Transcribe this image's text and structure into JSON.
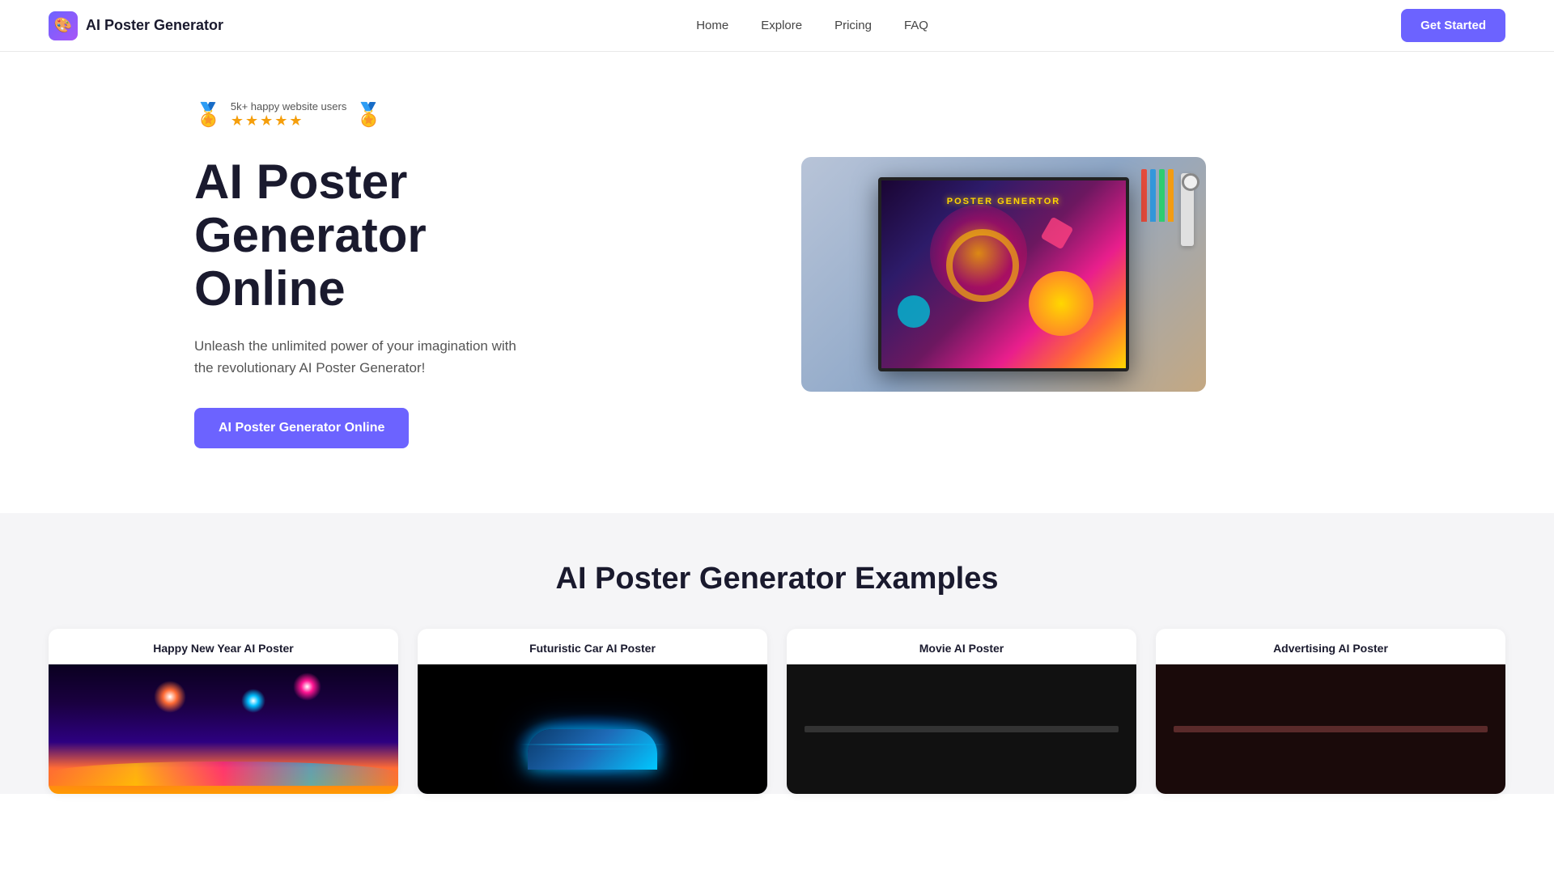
{
  "nav": {
    "logo_icon": "🎨",
    "logo_text": "AI Poster Generator",
    "links": [
      {
        "label": "Home",
        "id": "home"
      },
      {
        "label": "Explore",
        "id": "explore"
      },
      {
        "label": "Pricing",
        "id": "pricing"
      },
      {
        "label": "FAQ",
        "id": "faq"
      }
    ],
    "cta_label": "Get Started"
  },
  "hero": {
    "badge_users": "5k+ happy website users",
    "stars": "★★★★★",
    "title_line1": "AI Poster",
    "title_line2": "Generator",
    "title_line3": "Online",
    "subtitle": "Unleash the unlimited power of your imagination with the revolutionary AI Poster Generator!",
    "cta_label": "AI Poster Generator Online",
    "poster_label": "POSTER GENERTOR"
  },
  "examples": {
    "section_title": "AI Poster Generator Examples",
    "cards": [
      {
        "title": "Happy New Year AI Poster",
        "type": "new-year"
      },
      {
        "title": "Futuristic Car AI Poster",
        "type": "car"
      },
      {
        "title": "Movie AI Poster",
        "type": "movie"
      },
      {
        "title": "Advertising AI Poster",
        "type": "advertising"
      }
    ]
  }
}
